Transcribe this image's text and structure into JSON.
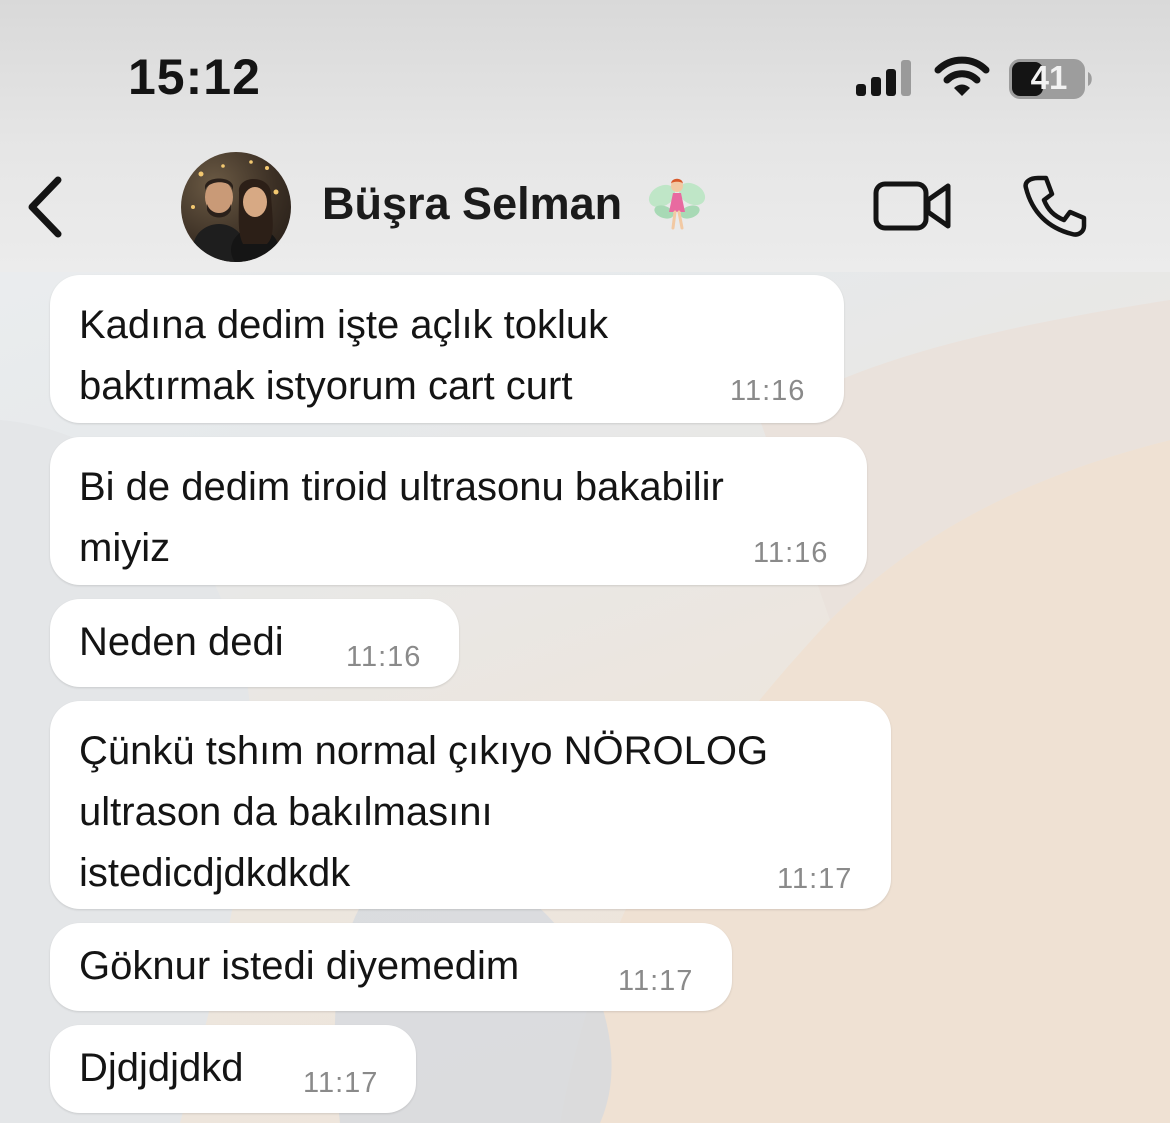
{
  "status_bar": {
    "time": "15:12",
    "battery": "41"
  },
  "header": {
    "contact_name": "Büşra Selman",
    "name_emoji": "fairy-icon"
  },
  "messages": [
    {
      "text": "Kadına dedim işte açlık tokluk\nbaktırmak istyorum cart curt",
      "time": "11:16"
    },
    {
      "text": "Bi de dedim tiroid ultrasonu bakabilir\nmiyiz",
      "time": "11:16"
    },
    {
      "text": "Neden dedi",
      "time": "11:16"
    },
    {
      "text": "Çünkü tshım normal çıkıyo NÖROLOG\nultrason da bakılmasını\nistedicdjdkdkdk",
      "time": "11:17"
    },
    {
      "text": "Göknur istedi diyemedim",
      "time": "11:17"
    },
    {
      "text": "Djdjdjdkd",
      "time": "11:17"
    }
  ],
  "colors": {
    "bubble": "#ffffff",
    "text": "#141414",
    "timestamp": "#8a8a8a",
    "fairy_wings": "#bfe6c7",
    "fairy_dress": "#e86aa0"
  }
}
